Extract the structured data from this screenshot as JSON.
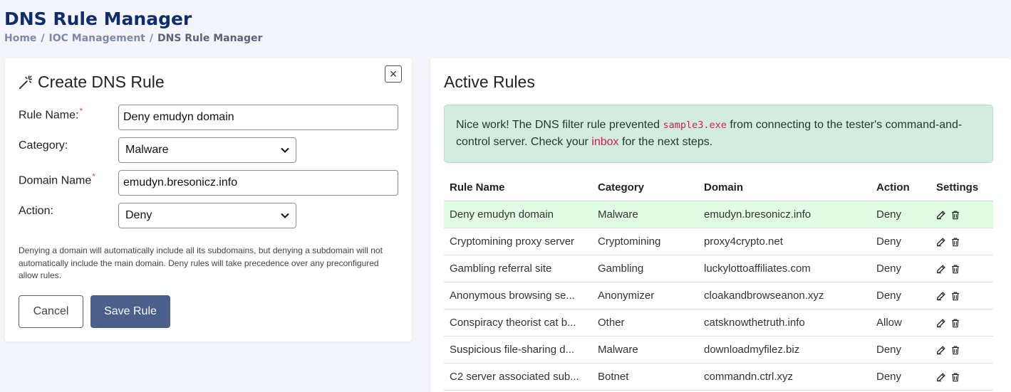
{
  "page": {
    "title": "DNS Rule Manager",
    "breadcrumb": [
      "Home",
      "IOC Management",
      "DNS Rule Manager"
    ],
    "breadcrumb_sep": "/"
  },
  "create_form": {
    "title": "Create DNS Rule",
    "close_symbol": "×",
    "rule_name_label": "Rule Name:",
    "rule_name_value": "Deny emudyn domain",
    "category_label": "Category:",
    "category_value": "Malware",
    "domain_label": "Domain Name",
    "domain_value": "emudyn.bresonicz.info",
    "action_label": "Action:",
    "action_value": "Deny",
    "required_mark": "*",
    "help_text": "Denying a domain will automatically include all its subdomains, but denying a subdomain will not automatically include the main domain. Deny rules will take precedence over any preconfigured allow rules.",
    "cancel_label": "Cancel",
    "save_label": "Save Rule"
  },
  "active_rules": {
    "title": "Active Rules",
    "alert": {
      "prefix": "Nice work! The DNS filter rule prevented ",
      "code": "sample3.exe",
      "middle": " from connecting to the tester's command-and-control server. Check your ",
      "link": "inbox",
      "suffix": " for the next steps."
    },
    "columns": [
      "Rule Name",
      "Category",
      "Domain",
      "Action",
      "Settings"
    ],
    "rows": [
      {
        "name": "Deny emudyn domain",
        "category": "Malware",
        "domain": "emudyn.bresonicz.info",
        "action": "Deny"
      },
      {
        "name": "Cryptomining proxy server",
        "category": "Cryptomining",
        "domain": "proxy4crypto.net",
        "action": "Deny"
      },
      {
        "name": "Gambling referral site",
        "category": "Gambling",
        "domain": "luckylottoaffiliates.com",
        "action": "Deny"
      },
      {
        "name": "Anonymous browsing se...",
        "category": "Anonymizer",
        "domain": "cloakandbrowseanon.xyz",
        "action": "Deny"
      },
      {
        "name": "Conspiracy theorist cat b...",
        "category": "Other",
        "domain": "catsknowthetruth.info",
        "action": "Allow"
      },
      {
        "name": "Suspicious file-sharing d...",
        "category": "Malware",
        "domain": "downloadmyfilez.biz",
        "action": "Deny"
      },
      {
        "name": "C2 server associated sub...",
        "category": "Botnet",
        "domain": "commandn.ctrl.xyz",
        "action": "Deny"
      }
    ]
  },
  "colors": {
    "title": "#0f2d6b",
    "save_button": "#4a5f8c",
    "highlight_row": "#e2fbe4",
    "alert_bg": "#d4ebe0",
    "code_text": "#c7254e"
  }
}
